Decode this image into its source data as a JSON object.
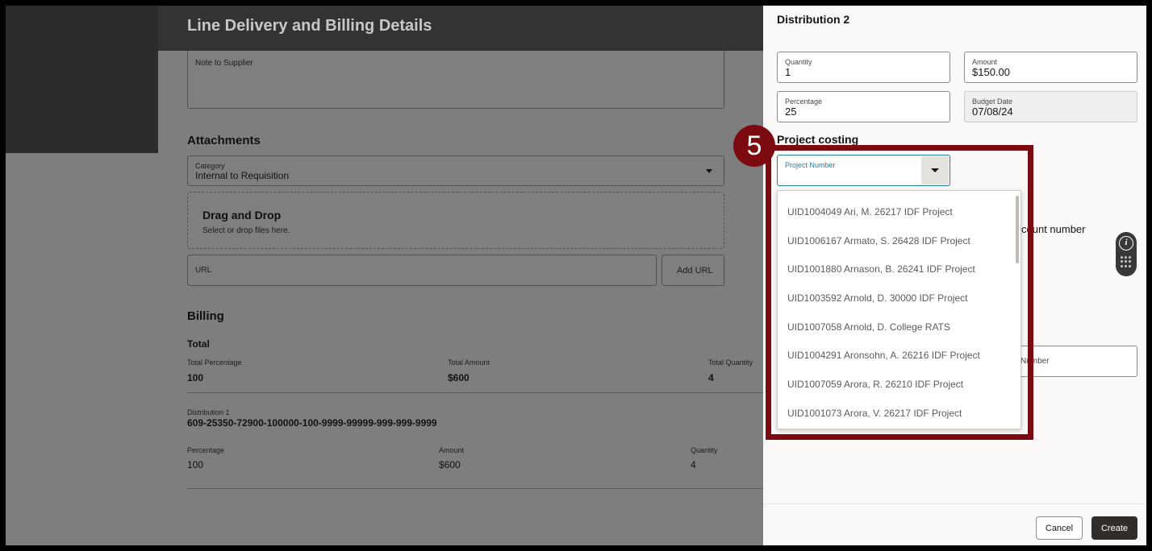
{
  "page": {
    "title": "Line Delivery and Billing Details",
    "note_to_supplier_label": "Note to Supplier",
    "attachments": {
      "heading": "Attachments",
      "category_label": "Category",
      "category_value": "Internal to Requisition",
      "dnd_title": "Drag and Drop",
      "dnd_hint": "Select or drop files here.",
      "url_placeholder": "URL",
      "add_url_label": "Add URL"
    },
    "billing": {
      "heading": "Billing",
      "total_heading": "Total",
      "total_percentage_label": "Total Percentage",
      "total_percentage": "100",
      "total_amount_label": "Total Amount",
      "total_amount": "$600",
      "total_quantity_label": "Total Quantity",
      "total_quantity": "4",
      "distribution1_label": "Distribution 1",
      "distribution1_account": "609-25350-72900-100000-100-9999-99999-999-999-9999",
      "percentage_label": "Percentage",
      "percentage": "100",
      "amount_label": "Amount",
      "amount": "$600",
      "quantity_label": "Quantity",
      "quantity": "4"
    }
  },
  "drawer": {
    "title": "Distribution 2",
    "quantity_label": "Quantity",
    "quantity": "1",
    "amount_label": "Amount",
    "amount": "$150.00",
    "percentage_label": "Percentage",
    "percentage": "25",
    "budget_date_label": "Budget Date",
    "budget_date": "07/08/24",
    "project_costing_heading": "Project costing",
    "project_number_label": "Project Number",
    "behind_text_1": "count number",
    "behind_text_2": "Number",
    "project_options": [
      "UID1004049 Ari, M. 26217 IDF Project",
      "UID1006167 Armato, S. 26428 IDF Project",
      "UID1001880 Arnason, B. 26241 IDF Project",
      "UID1003592 Arnold, D. 30000 IDF Project",
      "UID1007058 Arnold, D. College RATS",
      "UID1004291 Aronsohn, A. 26216 IDF Project",
      "UID1007059 Arora, R. 26210 IDF Project",
      "UID1001073 Arora, V. 26217 IDF Project"
    ],
    "cancel_label": "Cancel",
    "create_label": "Create"
  },
  "annotation": {
    "step_number": "5",
    "color": "#7b0b11"
  },
  "widget": {
    "info_glyph": "i",
    "icons": [
      "info-icon",
      "grid-dots-icon"
    ]
  }
}
